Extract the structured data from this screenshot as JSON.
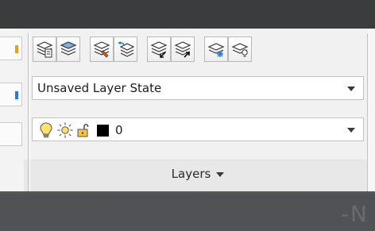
{
  "ribbon": {
    "icons": [
      {
        "name": "layer-properties-icon"
      },
      {
        "name": "layer-states-icon"
      },
      {
        "name": "match-layer-icon"
      },
      {
        "name": "previous-layer-icon"
      },
      {
        "name": "isolate-layer-icon"
      },
      {
        "name": "unisolate-layer-icon"
      },
      {
        "name": "freeze-layer-icon"
      },
      {
        "name": "off-layer-icon"
      }
    ],
    "layer_state": {
      "value": "Unsaved Layer State"
    },
    "current_layer": {
      "name": "0",
      "color": "#000000",
      "status_icons": [
        "lightbulb-icon",
        "sun-icon",
        "unlock-icon"
      ]
    },
    "panel_title": "Layers"
  }
}
